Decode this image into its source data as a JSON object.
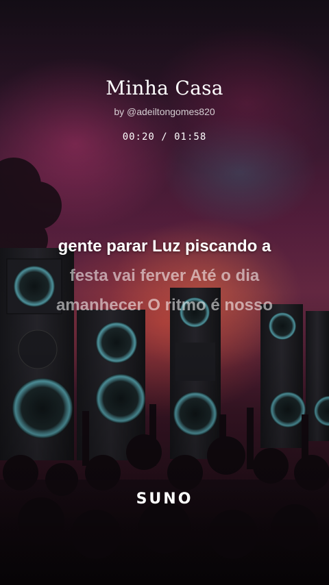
{
  "song": {
    "title": "Minha Casa",
    "byline": "by @adeiltongomes820",
    "time": "00:20 / 01:58"
  },
  "lyrics": [
    "gente parar Luz piscando a",
    "festa vai ferver Até o dia",
    "amanhecer O ritmo é nosso"
  ],
  "brand": {
    "name": "SUNO"
  },
  "colors": {
    "text": "#ffffff",
    "speaker": "#1c1c20",
    "cone_glow": "#5fb8c4",
    "stage_glow": "#e8583c"
  }
}
